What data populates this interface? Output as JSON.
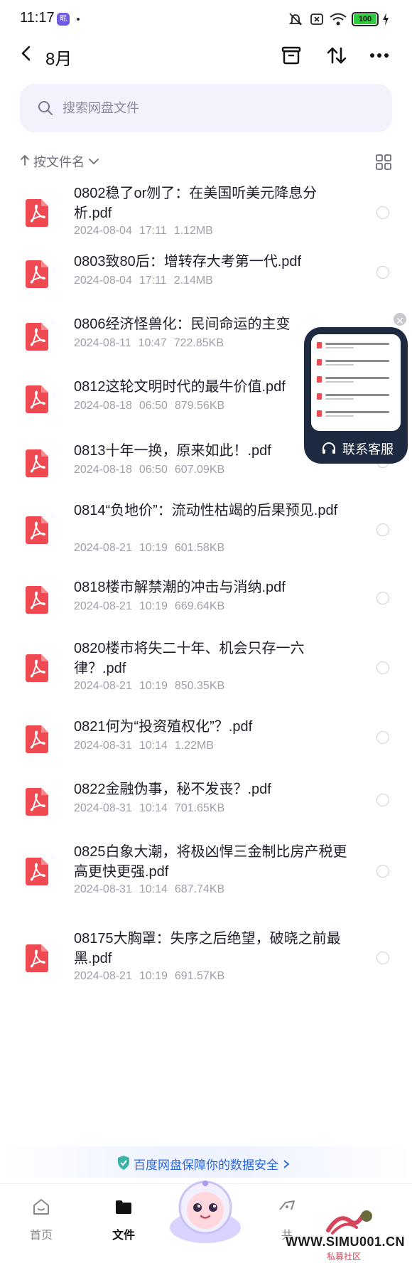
{
  "status_bar": {
    "time": "11:17",
    "app_badge": "昵",
    "battery": "100"
  },
  "header": {
    "title": "8月"
  },
  "search": {
    "placeholder": "搜索网盘文件"
  },
  "sort": {
    "label": "按文件名"
  },
  "files": [
    {
      "name": "0802稳了or刎了：在美国听美元降息分析.pdf",
      "date": "2024-08-04",
      "time": "17:11",
      "size": "1.12MB"
    },
    {
      "name": "0803致80后：增转存大考第一代.pdf",
      "date": "2024-08-04",
      "time": "17:11",
      "size": "2.14MB"
    },
    {
      "name": "0806经济怪兽化：民间命运的主变",
      "date": "2024-08-11",
      "time": "10:47",
      "size": "722.85KB"
    },
    {
      "name": "0812这轮文明时代的最牛价值.pdf",
      "date": "2024-08-18",
      "time": "06:50",
      "size": "879.56KB"
    },
    {
      "name": "0813十年一换，原来如此！.pdf",
      "date": "2024-08-18",
      "time": "06:50",
      "size": "607.09KB"
    },
    {
      "name": "0814“负地价”：流动性枯竭的后果预见.pdf",
      "date": "2024-08-21",
      "time": "10:19",
      "size": "601.58KB"
    },
    {
      "name": "0818楼市解禁潮的冲击与消纳.pdf",
      "date": "2024-08-21",
      "time": "10:19",
      "size": "669.64KB"
    },
    {
      "name": "0820楼市将失二十年、机会只存一六律？.pdf",
      "date": "2024-08-21",
      "time": "10:19",
      "size": "850.35KB"
    },
    {
      "name": "0821何为“投资殖权化”？.pdf",
      "date": "2024-08-31",
      "time": "10:14",
      "size": "1.22MB"
    },
    {
      "name": "0822金融伪事，秘不发丧？.pdf",
      "date": "2024-08-31",
      "time": "10:14",
      "size": "701.65KB"
    },
    {
      "name": "0825白象大潮，将极凶悍三金制比房产税更高更快更强.pdf",
      "date": "2024-08-31",
      "time": "10:14",
      "size": "687.74KB"
    },
    {
      "name": "08175大胸罩：失序之后绝望，破晓之前最黑.pdf",
      "date": "2024-08-21",
      "time": "10:19",
      "size": "691.57KB"
    }
  ],
  "service_widget": {
    "label": "联系客服"
  },
  "security_banner": {
    "text": "百度网盘保障你的数据安全"
  },
  "bottom_nav": {
    "items": [
      {
        "label": "首页",
        "icon": "home-icon"
      },
      {
        "label": "文件",
        "icon": "folder-icon"
      },
      {
        "label": "共",
        "icon": "share-icon"
      }
    ]
  },
  "watermark": {
    "text": "WWW.SIMU001.CN",
    "sub": "私募社区"
  },
  "colors": {
    "pdf_red": "#ef4a52",
    "link_blue": "#2a66d9",
    "widget_dark": "#1e2a40"
  }
}
